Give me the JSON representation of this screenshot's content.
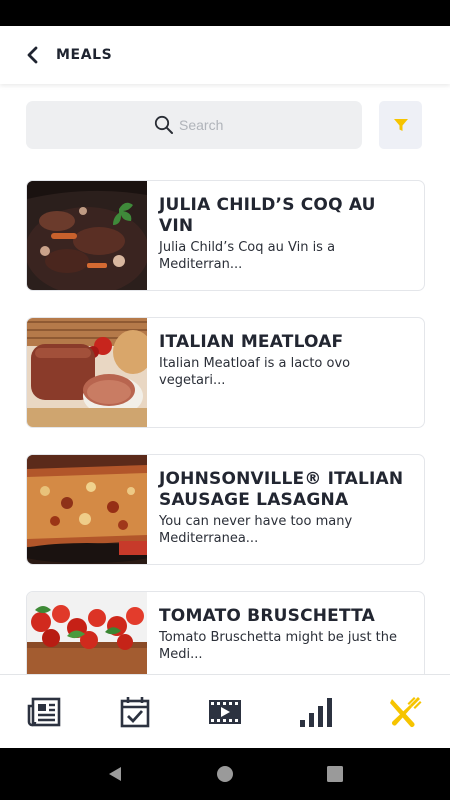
{
  "header": {
    "title": "MEALS"
  },
  "search": {
    "placeholder": "Search",
    "value": ""
  },
  "colors": {
    "accent": "#f6c400",
    "nav_icon": "#2c3240",
    "card_border": "#e4e6ea"
  },
  "meals": [
    {
      "title": "JULIA CHILD’S COQ AU VIN",
      "description": "Julia Child’s Coq au Vin is a Mediterran..."
    },
    {
      "title": "ITALIAN MEATLOAF",
      "description": "Italian Meatloaf is a lacto ovo vegetari..."
    },
    {
      "title": "JOHNSONVILLE® ITALIAN SAUSAGE LASAGNA",
      "description": "You can never have too many Mediterranea..."
    },
    {
      "title": "TOMATO BRUSCHETTA",
      "description": "Tomato Bruschetta might be just the Medi..."
    }
  ],
  "bottom_nav": {
    "items": [
      {
        "icon": "news-icon",
        "active": false
      },
      {
        "icon": "calendar-check-icon",
        "active": false
      },
      {
        "icon": "video-icon",
        "active": false
      },
      {
        "icon": "bar-chart-icon",
        "active": false
      },
      {
        "icon": "fork-knife-icon",
        "active": true
      }
    ]
  },
  "system_nav": {
    "items": [
      "back-triangle-icon",
      "home-circle-icon",
      "recents-square-icon"
    ]
  }
}
